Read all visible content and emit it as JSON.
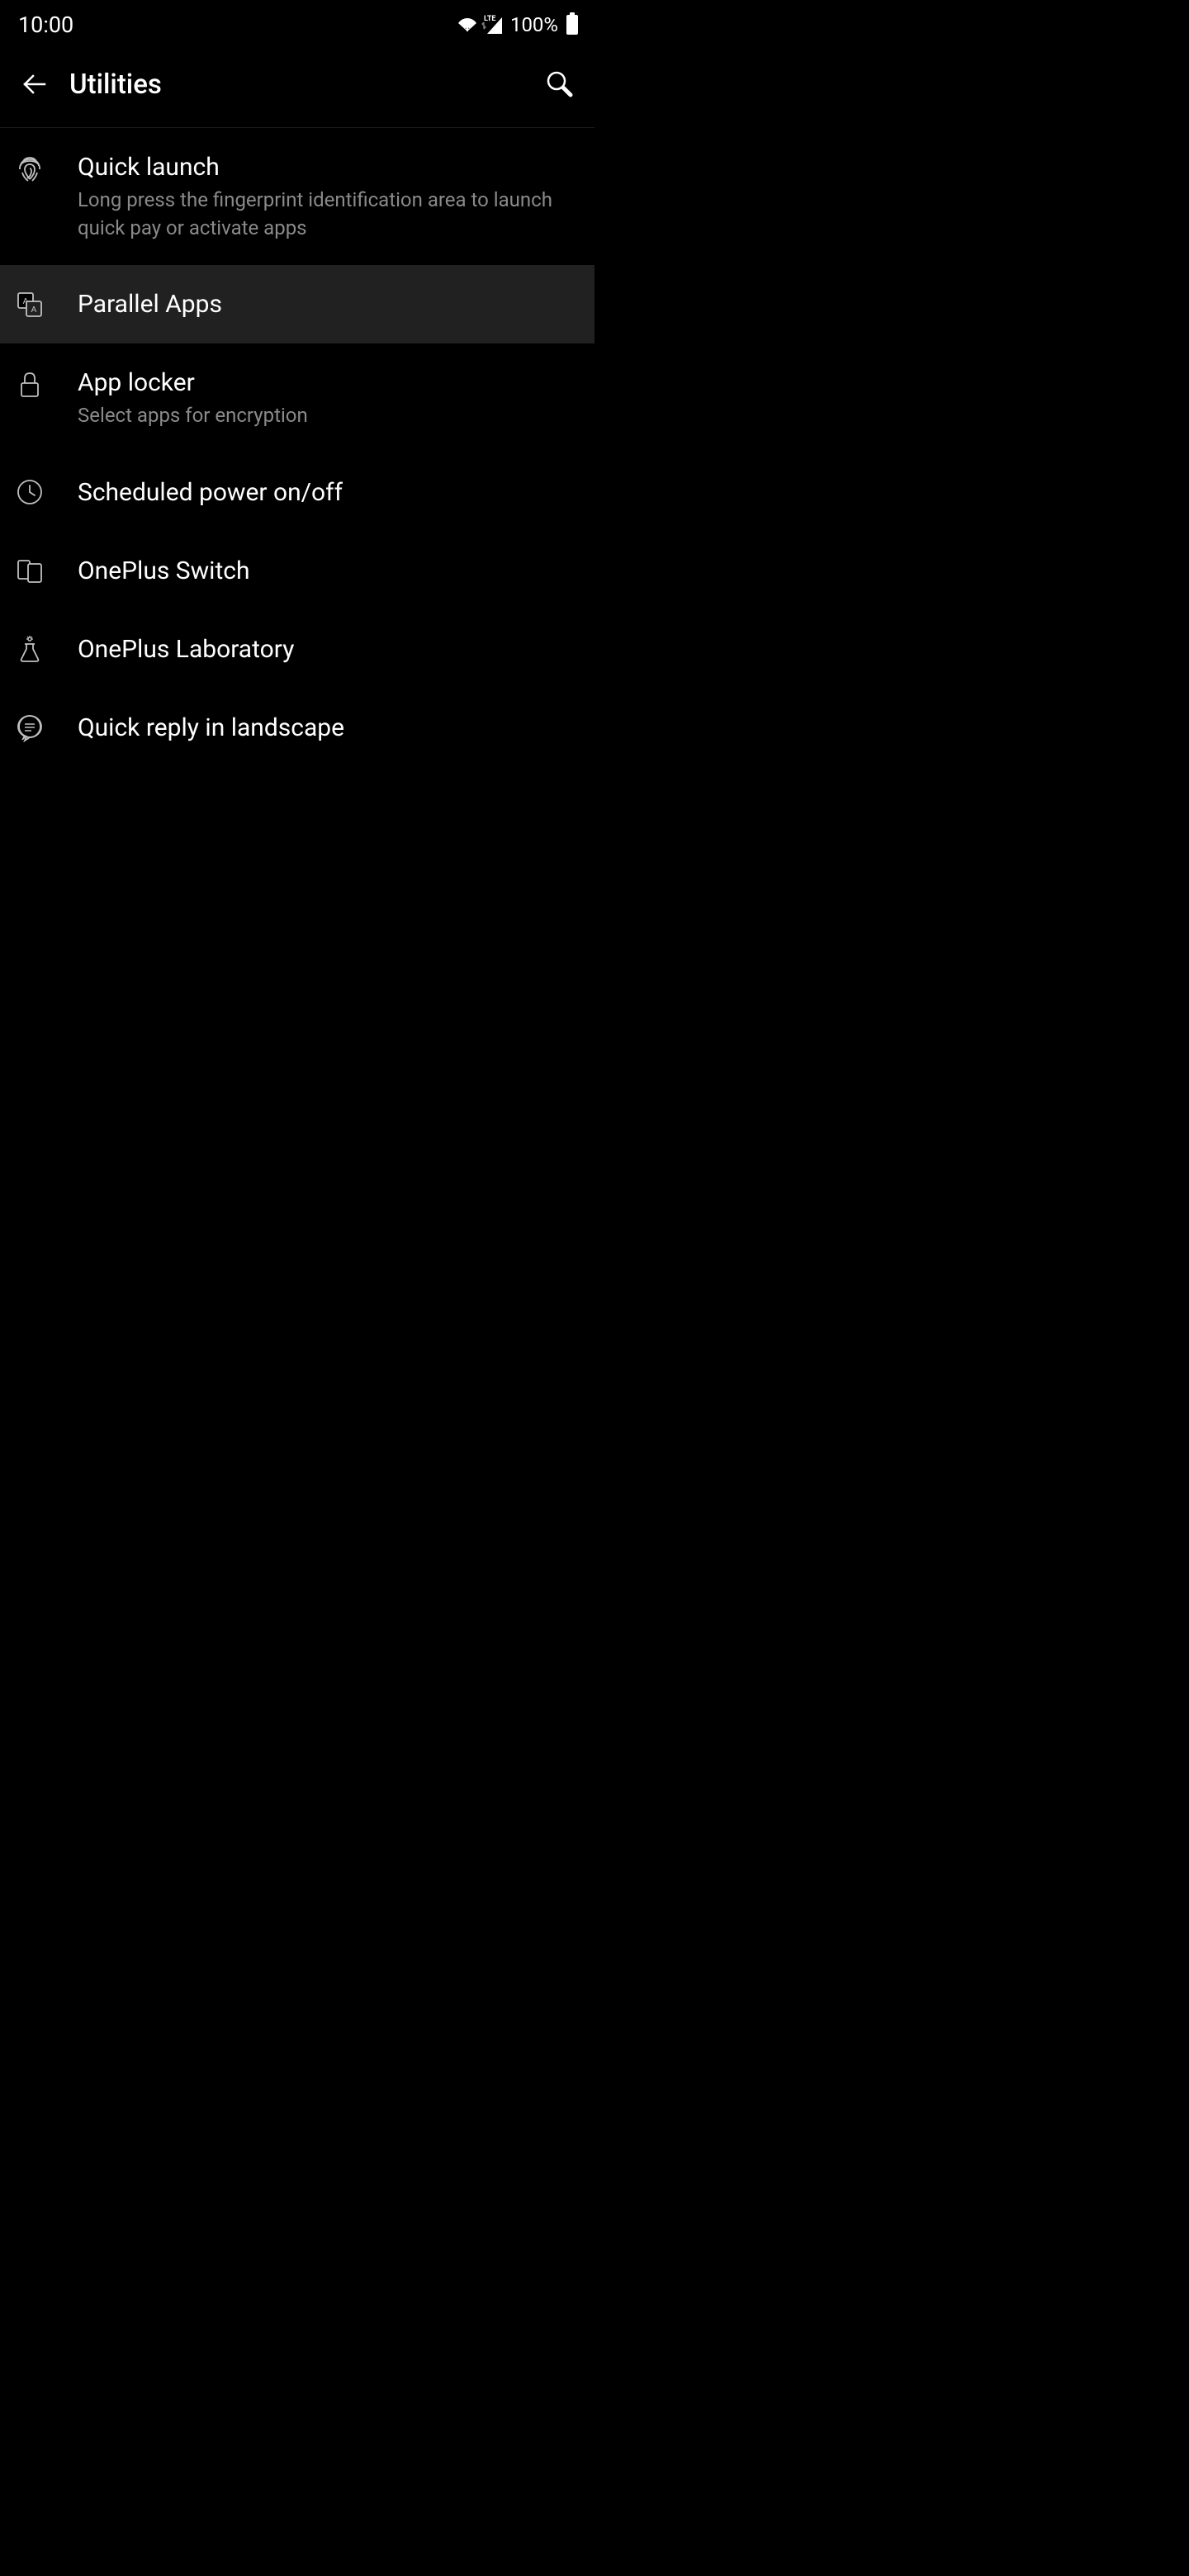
{
  "status_bar": {
    "time": "10:00",
    "battery_percent": "100%",
    "lte_label": "LTE"
  },
  "header": {
    "title": "Utilities"
  },
  "list": {
    "items": [
      {
        "title": "Quick launch",
        "subtitle": "Long press the fingerprint identification area to launch quick pay or activate apps",
        "highlighted": false
      },
      {
        "title": "Parallel Apps",
        "subtitle": "",
        "highlighted": true
      },
      {
        "title": "App locker",
        "subtitle": "Select apps for encryption",
        "highlighted": false
      },
      {
        "title": "Scheduled power on/off",
        "subtitle": "",
        "highlighted": false
      },
      {
        "title": "OnePlus Switch",
        "subtitle": "",
        "highlighted": false
      },
      {
        "title": "OnePlus Laboratory",
        "subtitle": "",
        "highlighted": false
      },
      {
        "title": "Quick reply in landscape",
        "subtitle": "",
        "highlighted": false
      }
    ]
  }
}
